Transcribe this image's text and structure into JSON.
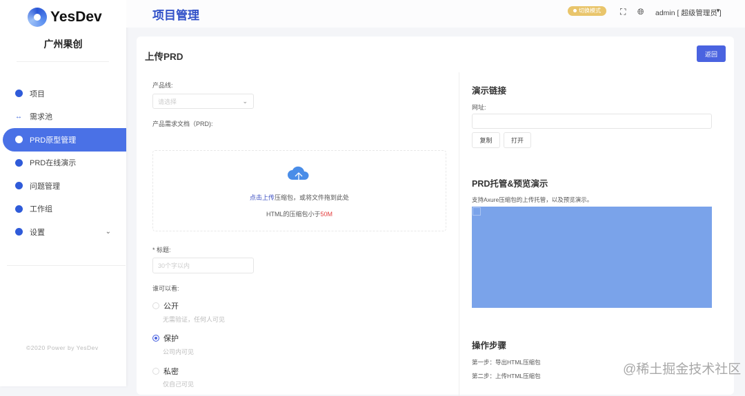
{
  "brand": {
    "name": "YesDev",
    "org": "广州果创"
  },
  "sidebar": {
    "items": [
      {
        "label": "项目"
      },
      {
        "label": "需求池"
      },
      {
        "label": "PRD原型管理"
      },
      {
        "label": "PRD在线演示"
      },
      {
        "label": "问题管理"
      },
      {
        "label": "工作组"
      },
      {
        "label": "设置"
      }
    ],
    "copyright": "©2020 Power by YesDev"
  },
  "header": {
    "title": "项目管理",
    "mode_badge": "切换模式",
    "user": "admin [ 超级管理员 ]"
  },
  "card": {
    "title": "上传PRD",
    "back": "返回"
  },
  "form": {
    "product_line_label": "产品线:",
    "product_line_placeholder": "请选择",
    "prd_label": "产品需求文档（PRD):",
    "upload_link": "点击上传",
    "upload_text": "压缩包，或将文件拖到此处",
    "upload_hint": "HTML的压缩包小于",
    "upload_limit": "50M",
    "title_label": "* 标题:",
    "title_placeholder": "30个字以内",
    "visibility_label": "谁可以看:",
    "options": [
      {
        "label": "公开",
        "desc": "无需验证，任何人可见"
      },
      {
        "label": "保护",
        "desc": "公司内可见"
      },
      {
        "label": "私密",
        "desc": "仅自己可见"
      }
    ]
  },
  "right": {
    "demo_title": "演示链接",
    "url_label": "网址:",
    "url_value": "",
    "copy": "复制",
    "open": "打开",
    "host_title": "PRD托管&预览演示",
    "host_desc": "支持Axure压缩包的上传托管，以及预览演示。",
    "steps_title": "操作步骤",
    "steps": [
      "第一步：导出HTML压缩包",
      "第二步：上传HTML压缩包"
    ]
  },
  "watermark": "@稀土掘金技术社区"
}
